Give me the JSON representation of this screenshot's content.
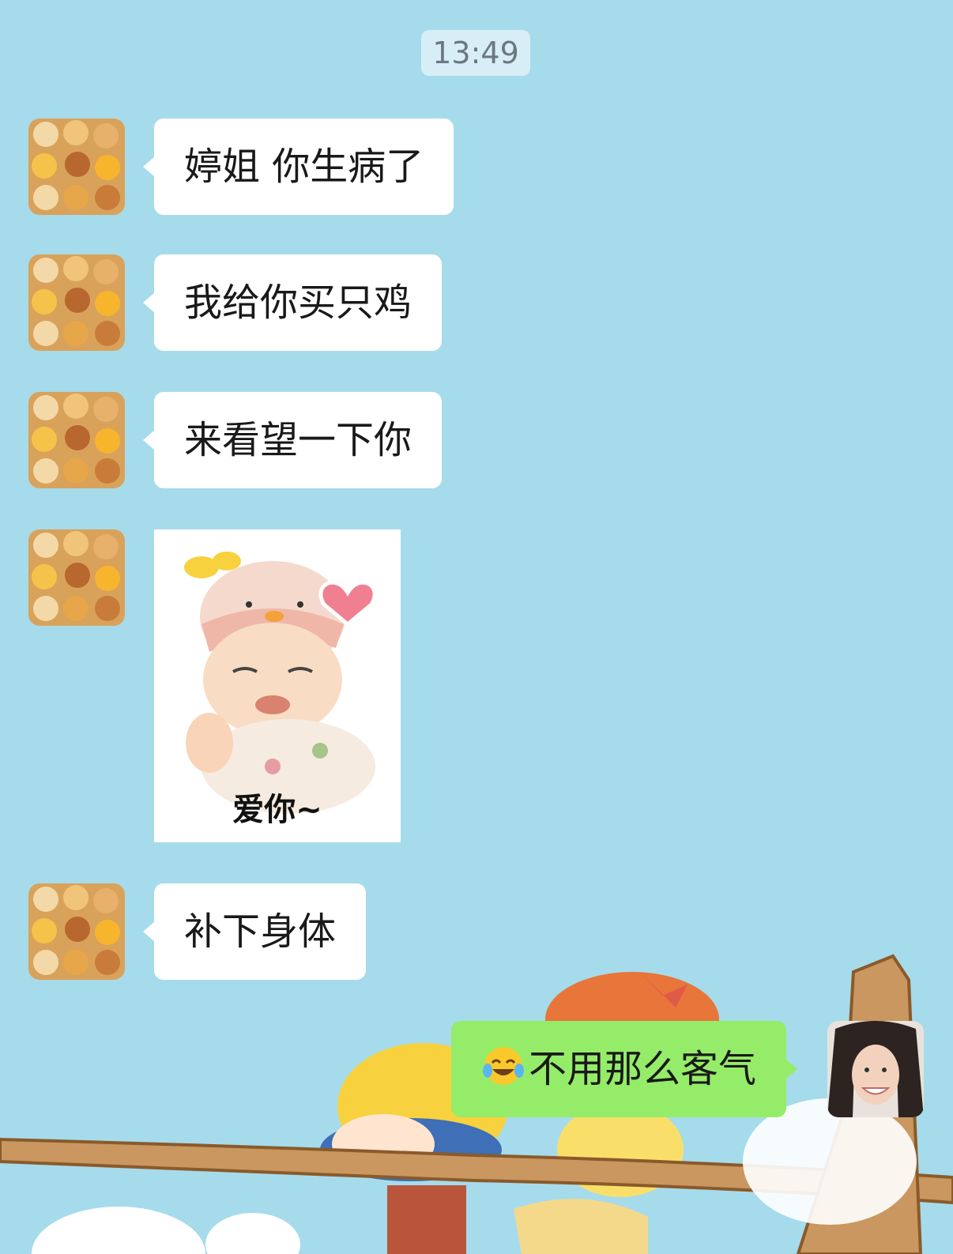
{
  "timestamp": "13:49",
  "messages": [
    {
      "sender": "other",
      "type": "text",
      "text": "婷姐 你生病了"
    },
    {
      "sender": "other",
      "type": "text",
      "text": "我给你买只鸡"
    },
    {
      "sender": "other",
      "type": "text",
      "text": "来看望一下你"
    },
    {
      "sender": "other",
      "type": "sticker",
      "caption": "爱你~"
    },
    {
      "sender": "other",
      "type": "text",
      "text": "补下身体"
    },
    {
      "sender": "me",
      "type": "text",
      "emoji": "tears-of-joy-emoji",
      "text": "不用那么客气"
    }
  ],
  "colors": {
    "background": "#a6dbeb",
    "incoming_bubble": "#ffffff",
    "outgoing_bubble": "#95ec69"
  }
}
